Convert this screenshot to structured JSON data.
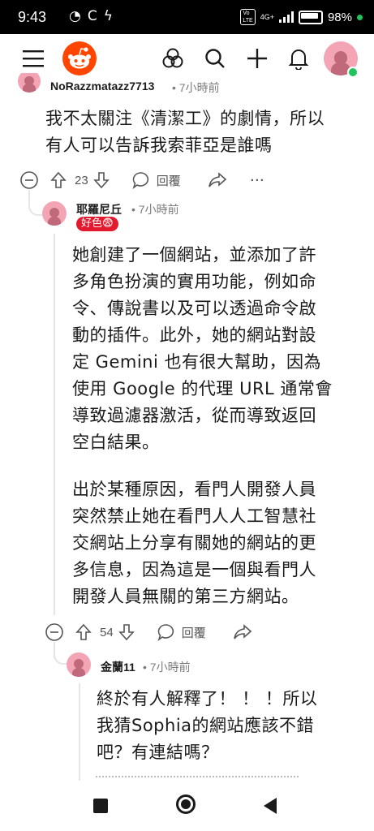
{
  "status_bar": {
    "time": "9:43",
    "battery": "98%",
    "network": "4G+"
  },
  "comments": [
    {
      "username": "NoRazzmatazz7713",
      "time": "7小時前",
      "lines": [
        "我不太關注《清潔工》的劇情，所以",
        "有人可以告訴我索菲亞是誰嗎"
      ],
      "votes": "23",
      "reply_label": "回覆"
    },
    {
      "username": "耶羅尼丘",
      "time": "7小時前",
      "flair": "好色😨",
      "paragraph1": [
        "她創建了一個網站，並添加了許",
        "多角色扮演的實用功能，例如命",
        "令、傳說書以及可以透過命令啟",
        "動的插件。此外，她的網站對設",
        "定 Gemini 也有很大幫助，因為",
        "使用 Google 的代理 URL 通常會",
        "導致過濾器激活，從而導致返回",
        "空白結果。"
      ],
      "paragraph2": [
        "出於某種原因，看門人開發人員",
        "突然禁止她在看門人人工智慧社",
        "交網站上分享有關她的網站的更",
        "多信息，因為這是一個與看門人",
        "開發人員無關的第三方網站。"
      ],
      "votes": "54",
      "reply_label": "回覆"
    },
    {
      "username": "金蘭11",
      "time": "7小時前",
      "lines": [
        "終於有人解釋了！ ！ ！所以",
        "我猜Sophia的網站應該不錯",
        "吧？有連結嗎？"
      ]
    }
  ]
}
